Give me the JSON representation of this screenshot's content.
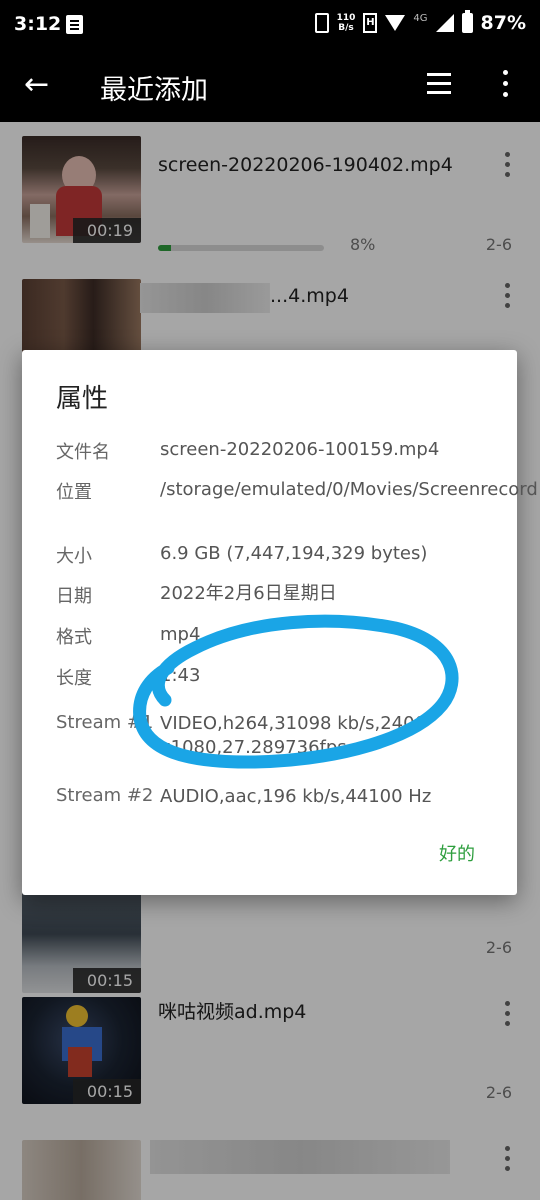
{
  "status_bar": {
    "time": "3:12",
    "net_speed_value": "110",
    "net_speed_unit": "B/s",
    "network_type": "4G",
    "battery": "87%"
  },
  "app_bar": {
    "title": "最近添加"
  },
  "list": {
    "items": [
      {
        "name": "screen-20220206-190402.mp4",
        "duration": "00:19",
        "progress_percent": 8,
        "progress_text": "8%",
        "date": "2-6"
      },
      {
        "name": "...4.mp4",
        "duration": "",
        "date": ""
      },
      {
        "name": "",
        "duration": "00:15",
        "date": "2-6"
      },
      {
        "name": "咪咕视频ad.mp4",
        "duration": "00:15",
        "date": "2-6"
      }
    ]
  },
  "dialog": {
    "title": "属性",
    "properties": [
      {
        "label": "文件名",
        "value": "screen-20220206-100159.mp4"
      },
      {
        "label": "位置",
        "value": "/storage/emulated/0/Movies/Screenrecord"
      },
      {
        "label": "大小",
        "value": "6.9 GB (7,447,194,329 bytes)"
      },
      {
        "label": "日期",
        "value": "2022年2月6日星期日"
      },
      {
        "label": "格式",
        "value": "mp4"
      },
      {
        "label": "长度",
        "value": "1:43"
      },
      {
        "label": "Stream #1",
        "value": "VIDEO,h264,31098 kb/s,2400x1080,27.289736fps"
      },
      {
        "label": "Stream #2",
        "value": "AUDIO,aac,196 kb/s,44100 Hz"
      }
    ],
    "ok_label": "好的"
  },
  "colors": {
    "accent": "#2e9e3e",
    "scribble": "#1aa5e6"
  }
}
